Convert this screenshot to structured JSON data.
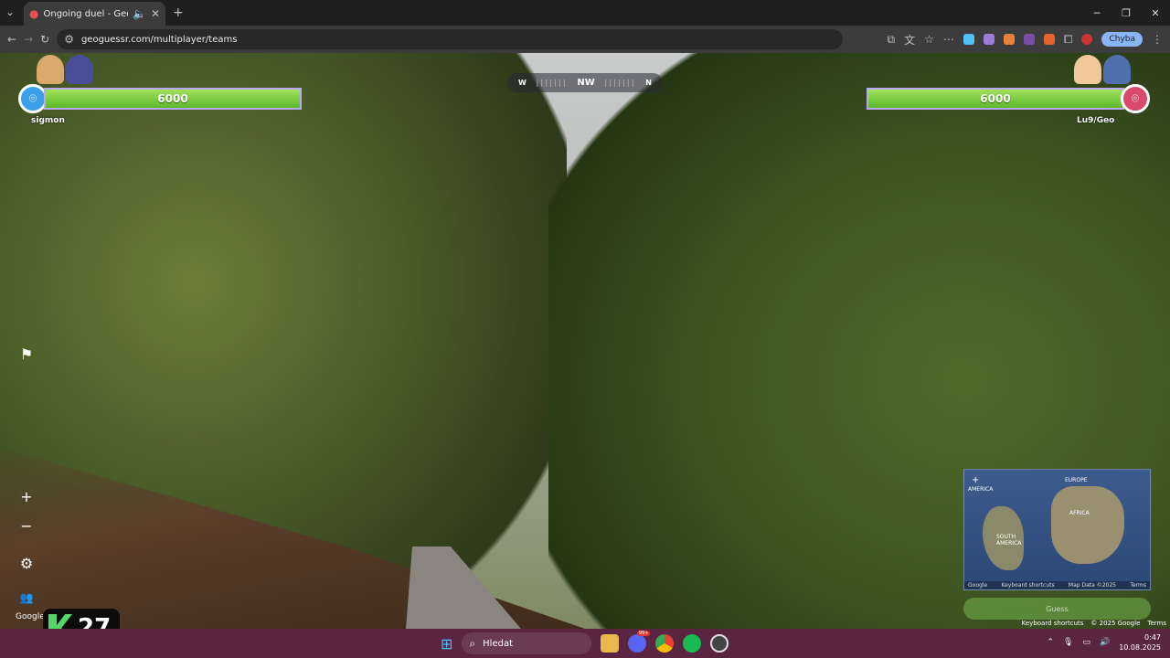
{
  "browser": {
    "tab_title": "Ongoing duel - GeoGuessr",
    "url": "geoguessr.com/multiplayer/teams",
    "profile_button": "Chyba"
  },
  "game": {
    "compass": {
      "left": "W",
      "center": "NW",
      "right": "N"
    },
    "player_left": {
      "name": "sigmon",
      "health": "6000"
    },
    "player_right": {
      "name": "Lu9/Geo",
      "health": "6000"
    },
    "round_timer": "27",
    "google_label": "Google"
  },
  "minimap": {
    "labels": {
      "europe": "EUROPE",
      "africa": "AFRICA",
      "south_america": "SOUTH AMERICA",
      "america": "AMERICA"
    },
    "footer_google": "Google",
    "footer_shortcuts": "Keyboard shortcuts",
    "footer_mapdata": "Map Data ©2025",
    "footer_terms": "Terms",
    "guess_label": "Guess"
  },
  "google_footer": {
    "shortcuts": "Keyboard shortcuts",
    "copyright": "© 2025 Google",
    "terms": "Terms"
  },
  "taskbar": {
    "search": "Hledat",
    "time": "0:47",
    "date": "10.08.2025",
    "discord_badge": "99+"
  }
}
